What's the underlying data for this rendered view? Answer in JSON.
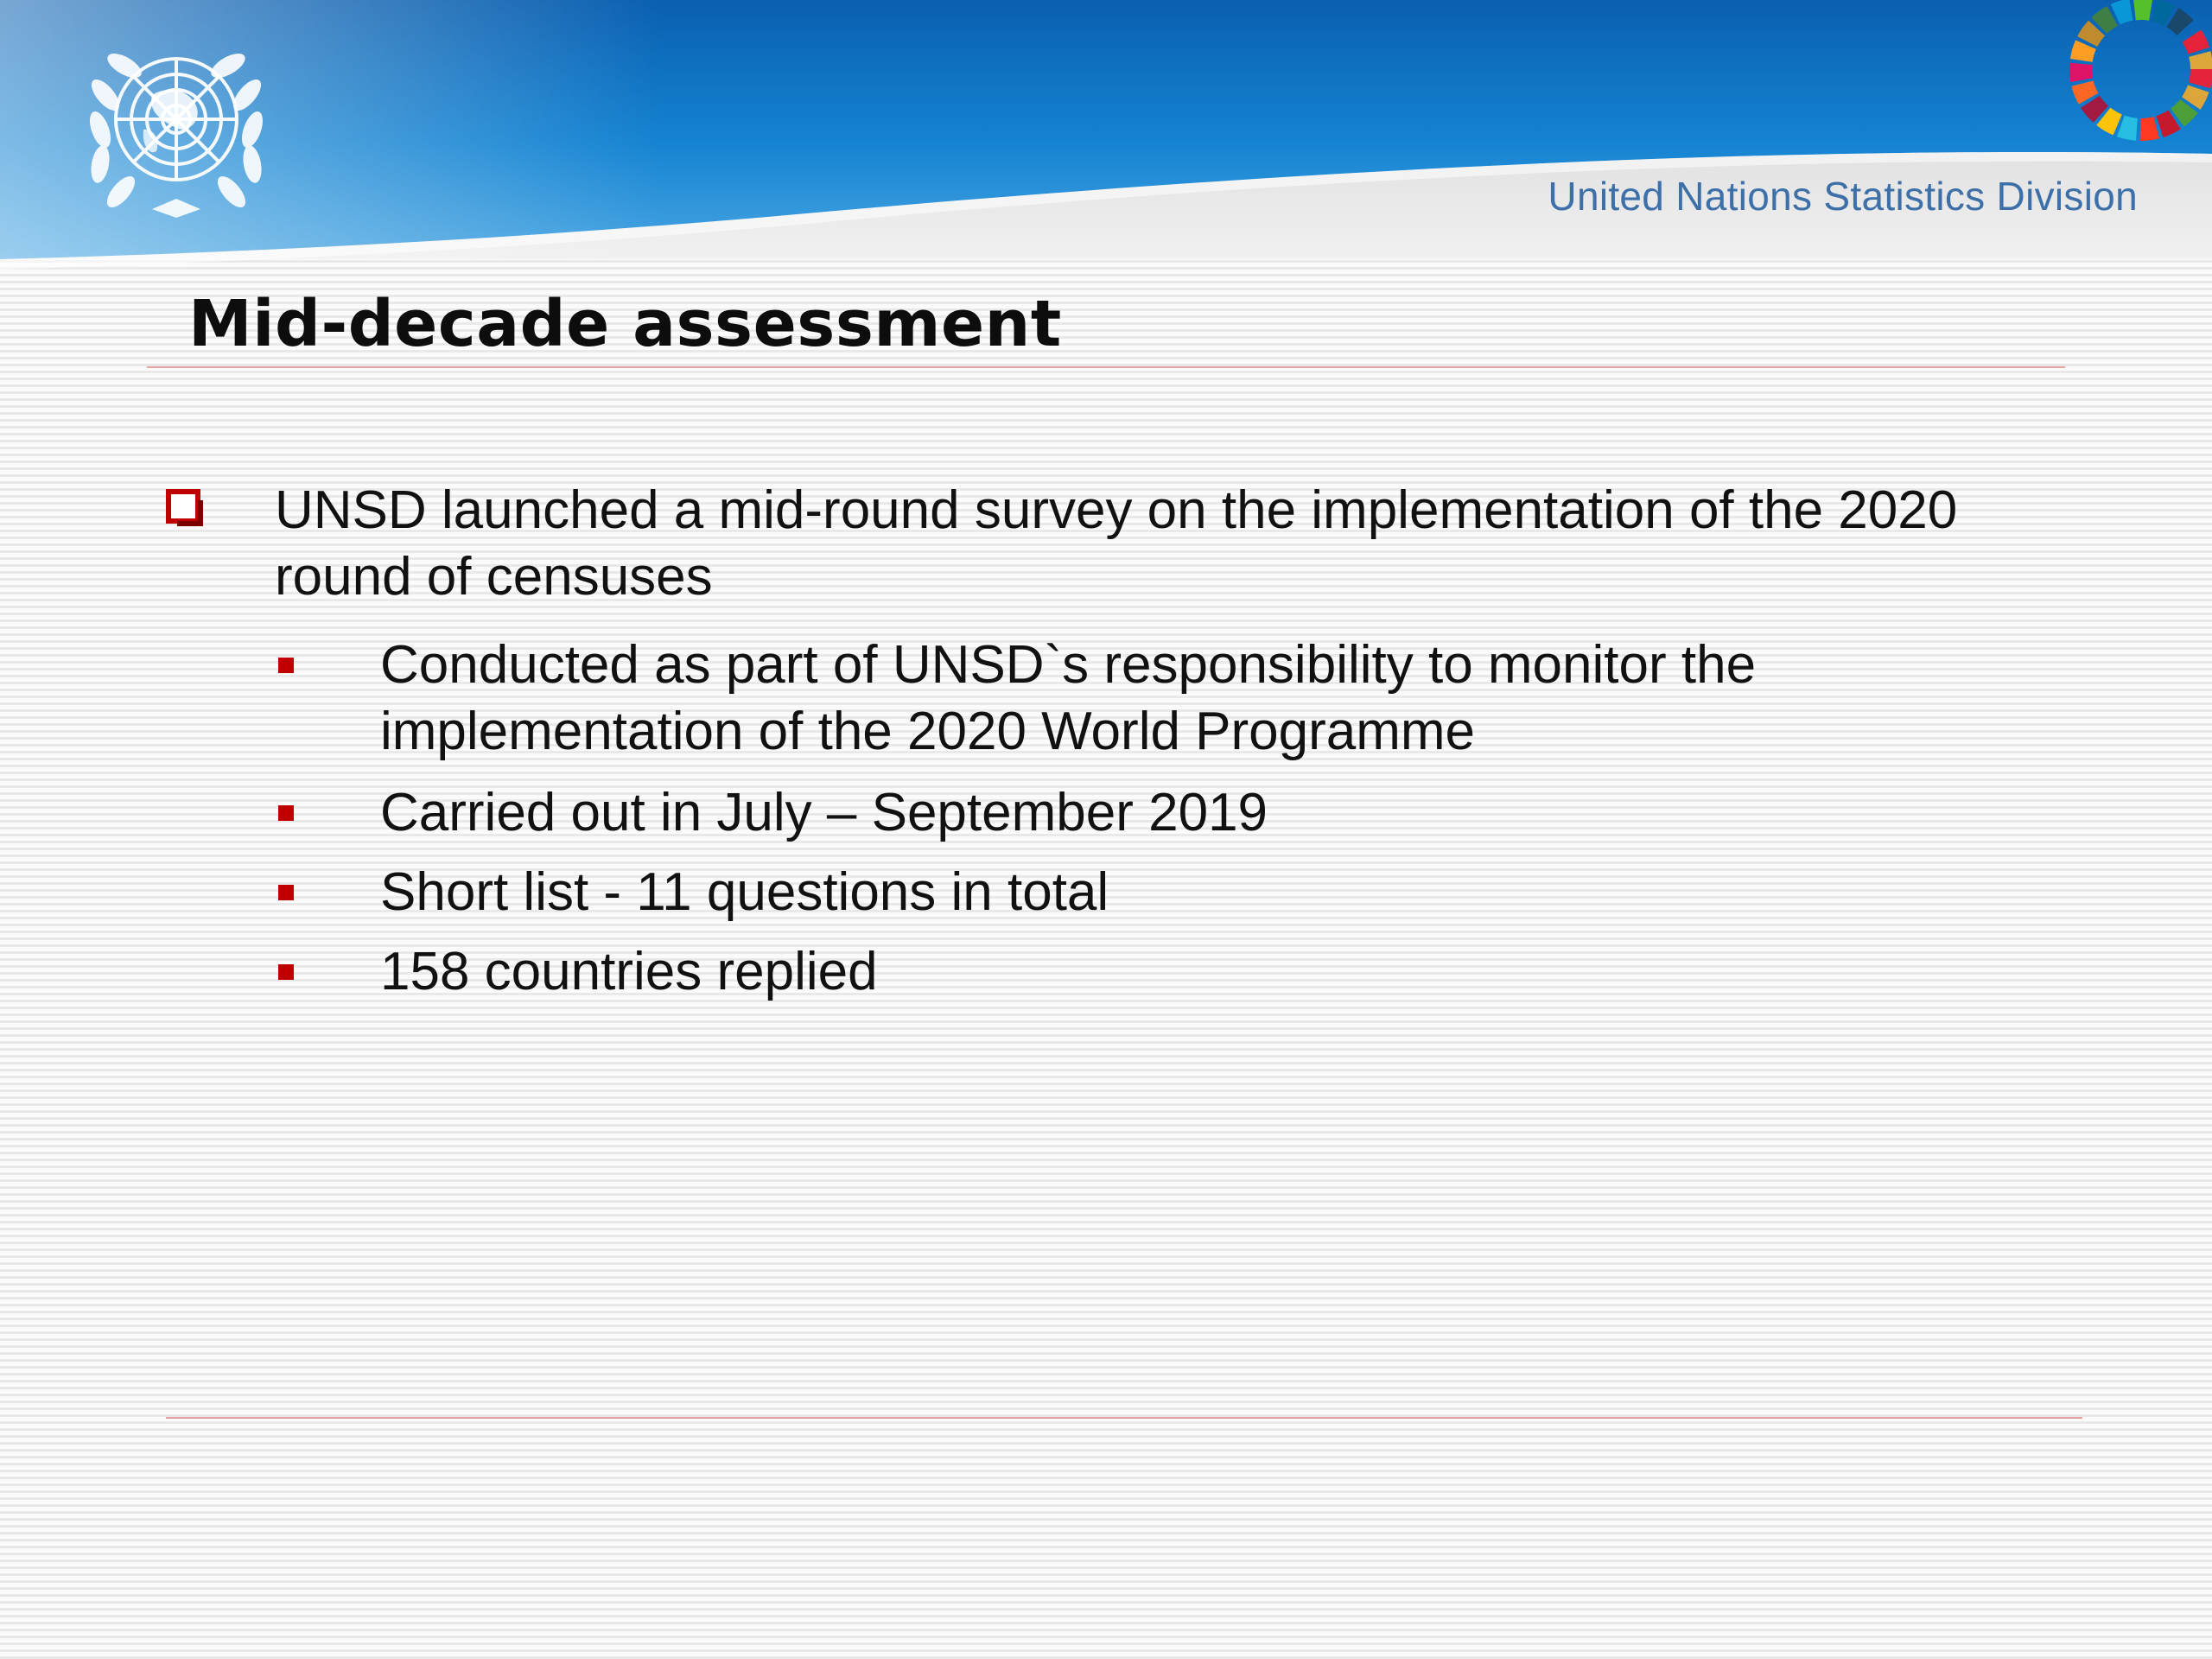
{
  "header": {
    "organization": "United Nations Statistics Division",
    "emblem_icon": "un-emblem-icon",
    "sdg_icon": "sdg-wheel-icon",
    "band_color": "#0a6fc0",
    "text_color": "#3d6fa8"
  },
  "slide": {
    "title": "Mid-decade assessment",
    "accent_color": "#c00000",
    "bullets": [
      {
        "text": "UNSD launched a mid-round survey on the implementation of the 2020 round of censuses",
        "marker": "hollow-square-icon",
        "subitems": [
          {
            "text": "Conducted as part of UNSD`s responsibility to monitor the implementation of the 2020 World Programme"
          },
          {
            "text": "Carried out in July – September 2019"
          },
          {
            "text": "Short list - 11 questions in total"
          },
          {
            "text": "158 countries replied"
          }
        ]
      }
    ]
  }
}
